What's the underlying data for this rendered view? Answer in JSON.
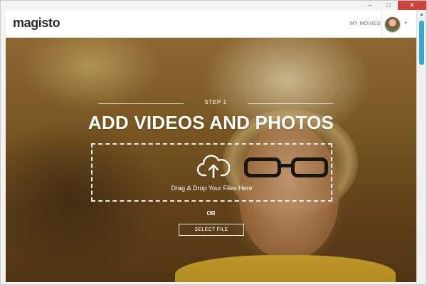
{
  "window": {
    "minimize": "–",
    "maximize": "□",
    "close": "✕"
  },
  "header": {
    "logo": "magisto",
    "my_movies": "MY MOVIES",
    "avatar_caret": "▾"
  },
  "hero": {
    "step_label": "STEP 1",
    "title": "ADD VIDEOS AND PHOTOS",
    "drop_text": "Drag & Drop Your Files Here",
    "or_text": "OR",
    "select_file": "SELECT FILE"
  },
  "icons": {
    "upload": "cloud-upload-icon",
    "avatar": "user-avatar"
  },
  "colors": {
    "scrollbar_thumb": "#3aa6cf",
    "close_button": "#c9453b",
    "header_bg": "#ffffff"
  }
}
